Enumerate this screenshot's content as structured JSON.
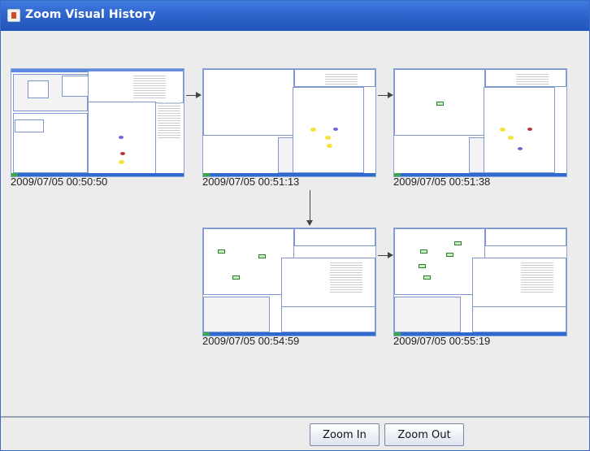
{
  "window": {
    "title": "Zoom Visual History"
  },
  "snapshots": [
    {
      "timestamp": "2009/07/05 00:50:50"
    },
    {
      "timestamp": "2009/07/05 00:51:13"
    },
    {
      "timestamp": "2009/07/05 00:51:38"
    },
    {
      "timestamp": "2009/07/05 00:54:59"
    },
    {
      "timestamp": "2009/07/05 00:55:19"
    }
  ],
  "buttons": {
    "zoom_in": "Zoom In",
    "zoom_out": "Zoom Out"
  },
  "colors": {
    "titlebar": "#2a5fc6",
    "taskbar": "#2f6ad1",
    "node_green": "#c8f0c0",
    "node_yellow": "#f5e23a"
  }
}
